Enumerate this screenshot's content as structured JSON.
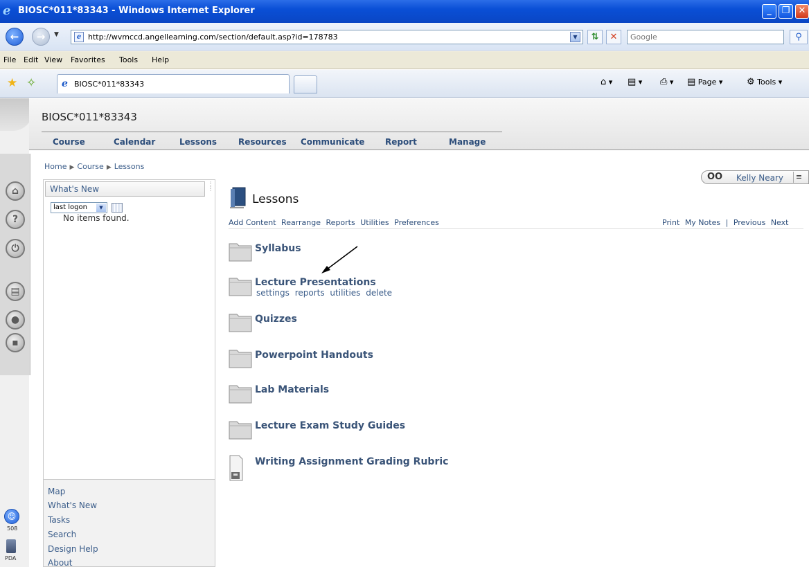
{
  "window": {
    "title": "BIOSC*011*83343 - Windows Internet Explorer",
    "minimize_glyph": "_",
    "restore_glyph": "❐",
    "close_glyph": "✕"
  },
  "address_bar": {
    "url": "http://wvmccd.angellearning.com/section/default.asp?id=178783",
    "search_placeholder": "Google"
  },
  "menu": [
    "File",
    "Edit",
    "View",
    "Favorites",
    "Tools",
    "Help"
  ],
  "tabs": {
    "active_label": "BIOSC*011*83343"
  },
  "command_bar": {
    "page_label": "Page",
    "tools_label": "Tools"
  },
  "course": {
    "title": "BIOSC*011*83343",
    "nav": [
      "Course",
      "Calendar",
      "Lessons",
      "Resources",
      "Communicate",
      "Report",
      "Manage"
    ]
  },
  "breadcrumb": [
    "Home",
    "Course",
    "Lessons"
  ],
  "whats_new": {
    "title": "What's New",
    "select_value": "last logon",
    "empty_text": "No items found.",
    "footer_links": [
      "Map",
      "What's New",
      "Tasks",
      "Search",
      "Design Help",
      "About"
    ]
  },
  "rail": {
    "label_508": "508",
    "label_pda": "PDA"
  },
  "user": {
    "name": "Kelly Neary"
  },
  "lessons": {
    "title": "Lessons",
    "toolbar_links": [
      "Add Content",
      "Rearrange",
      "Reports",
      "Utilities",
      "Preferences"
    ],
    "right_links": [
      "Print",
      "My Notes",
      "|",
      "Previous",
      "Next"
    ],
    "items": [
      {
        "title": "Syllabus",
        "kind": "folder"
      },
      {
        "title": "Lecture Presentations",
        "kind": "folder"
      },
      {
        "title": "Quizzes",
        "kind": "folder"
      },
      {
        "title": "Powerpoint Handouts",
        "kind": "folder"
      },
      {
        "title": "Lab Materials",
        "kind": "folder"
      },
      {
        "title": "Lecture Exam Study Guides",
        "kind": "folder"
      },
      {
        "title": "Writing Assignment Grading Rubric",
        "kind": "document"
      }
    ],
    "item_actions": [
      "settings",
      "reports",
      "utilities",
      "delete"
    ]
  },
  "colors": {
    "link": "#3b5d8a",
    "item_title": "#3a5478",
    "titlebar": "#0a4fd6"
  }
}
